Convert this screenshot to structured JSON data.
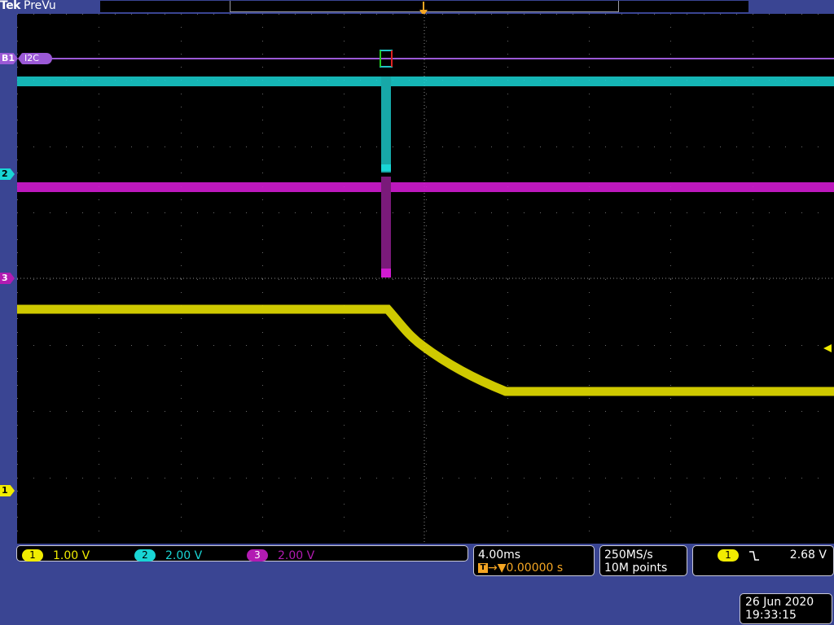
{
  "header": {
    "brand": "Tek",
    "mode": "PreVu"
  },
  "trigger_marker": "T",
  "channels": [
    {
      "id": "1",
      "scale": "1.00 V",
      "color": "#f1ec00"
    },
    {
      "id": "2",
      "scale": "2.00 V",
      "color": "#19d5d5"
    },
    {
      "id": "3",
      "scale": "2.00 V",
      "color": "#b21bb2"
    }
  ],
  "markers": {
    "bus": "B1",
    "bus_label": "I2C",
    "ch1": "1",
    "ch2": "2",
    "ch3": "3"
  },
  "timebase": {
    "scale": "4.00ms",
    "trigger_position": "0.00000 s"
  },
  "acquisition": {
    "sample_rate": "250MS/s",
    "record_length": "10M points"
  },
  "trigger": {
    "source": "1",
    "slope_icon": "falling-edge",
    "level": "2.68 V"
  },
  "datetime": {
    "date": "26 Jun 2020",
    "time": "19:33:15"
  }
}
